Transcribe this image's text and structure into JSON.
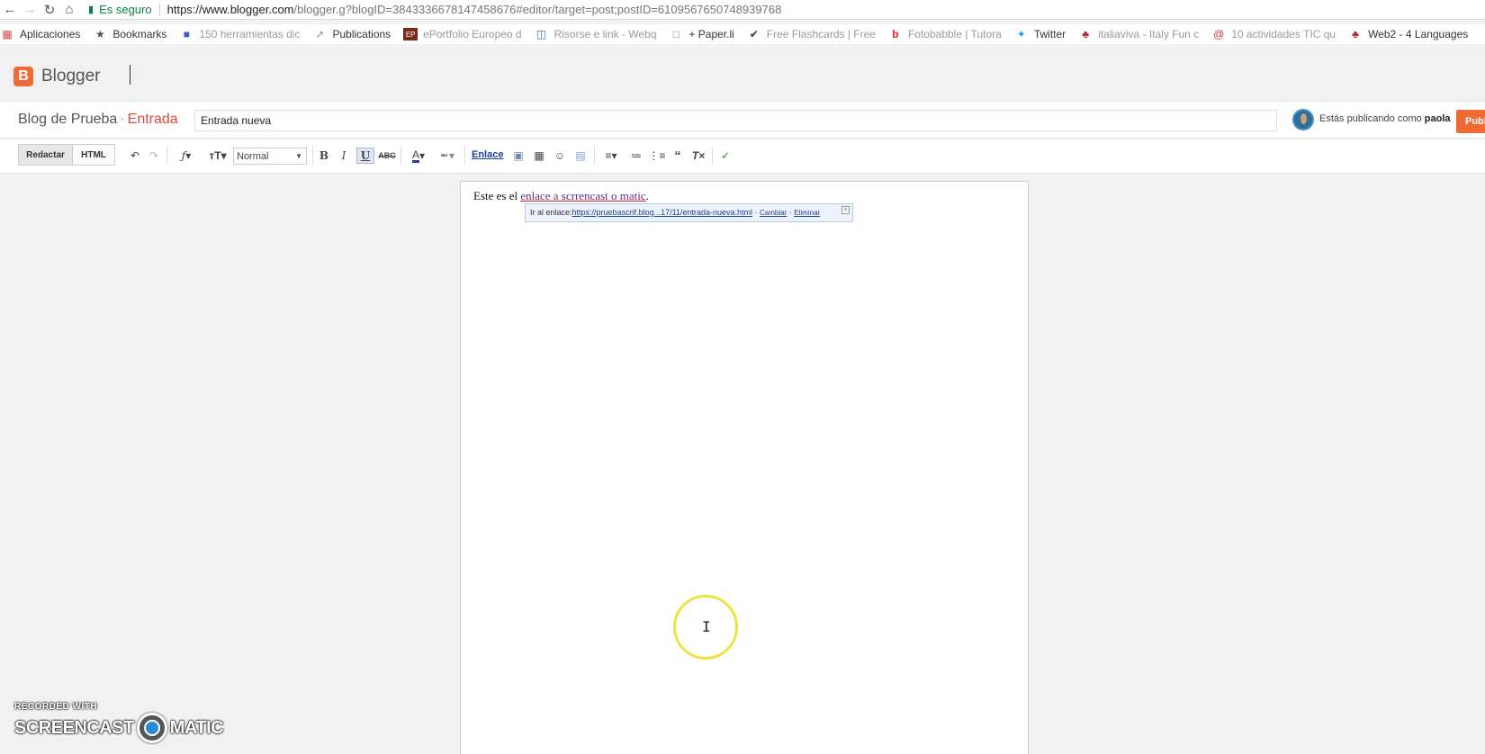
{
  "browser": {
    "secure_label": "Es seguro",
    "url_host": "https://www.blogger.com",
    "url_path": "/blogger.g?blogID=3843336678147458676#editor/target=post;postID=6109567650748939768"
  },
  "bookmarks": [
    {
      "label": "Aplicaciones",
      "icon": "apps-icon"
    },
    {
      "label": "Bookmarks",
      "icon": "star-icon"
    },
    {
      "label": "150 herramientas dic",
      "icon": "page-icon"
    },
    {
      "label": "Publications",
      "icon": "wand-icon"
    },
    {
      "label": "ePortfolio Europeo d",
      "icon": "eportfolio-icon"
    },
    {
      "label": "Risorse e link - Webq",
      "icon": "window-icon"
    },
    {
      "label": "+ Paper.li",
      "icon": "doc-icon"
    },
    {
      "label": "Free Flashcards | Free",
      "icon": "check-icon"
    },
    {
      "label": "Fotobabble | Tutora",
      "icon": "fotobabble-icon"
    },
    {
      "label": "Twitter",
      "icon": "twitter-icon"
    },
    {
      "label": "italiaviva - Italy Fun c",
      "icon": "plant-icon"
    },
    {
      "label": "10 actividades TIC qu",
      "icon": "at-icon"
    },
    {
      "label": "Web2 - 4 Languages",
      "icon": "plant-icon"
    }
  ],
  "app": {
    "logo_letter": "B",
    "logo_text": "Blogger"
  },
  "post": {
    "blog_name": "Blog de Prueba",
    "separator": "·",
    "section": "Entrada",
    "title": "Entrada nueva",
    "publishing_as_prefix": "Estás publicando como",
    "publishing_as_user": "paola",
    "publish_label": "Publi"
  },
  "toolbar": {
    "compose_label": "Redactar",
    "html_label": "HTML",
    "format_value": "Normal",
    "link_label": "Enlace"
  },
  "editor": {
    "text_before": "Este es el ",
    "link_text": "enlace a scrrencast o matic",
    "text_after": ".",
    "bubble_prefix": "Ir al enlace:",
    "bubble_url": "https://pruebascrif.blog...17/11/entrada-nueva.html",
    "bubble_change": "Cambiar",
    "bubble_delete": "Eliminar",
    "bubble_sep": "-"
  },
  "watermark": {
    "line1": "RECORDED WITH",
    "word1": "SCREENCAST",
    "word2": "MATIC"
  }
}
